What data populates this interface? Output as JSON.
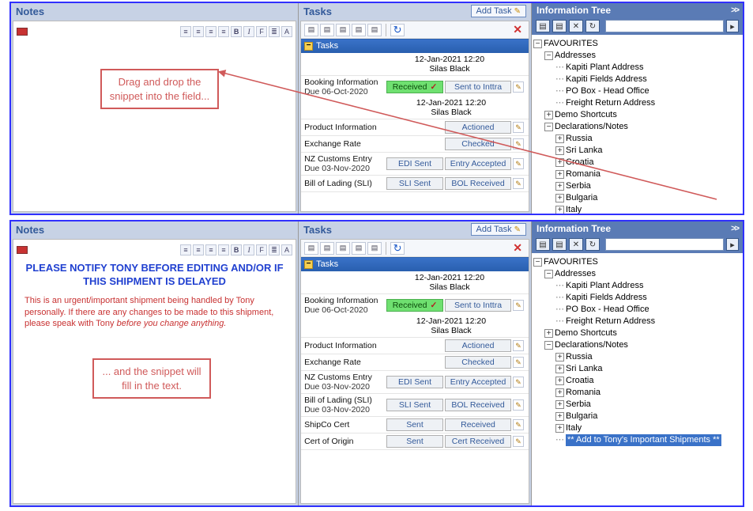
{
  "panels": {
    "notes_title": "Notes",
    "tasks_title": "Tasks",
    "tree_title": "Information Tree",
    "add_task_label": "Add Task",
    "tasks_group": "Tasks"
  },
  "callouts": {
    "top": "Drag and drop the snippet into the field...",
    "bottom": "... and the snippet will fill in the text."
  },
  "notes_filled": {
    "heading": "PLEASE NOTIFY TONY BEFORE EDITING AND/OR IF THIS SHIPMENT IS DELAYED",
    "para_pre": "This is an urgent/important shipment being handled by Tony personally. If there are any changes to be made to this shipment, please speak with Tony ",
    "para_em": "before you change anything.",
    "para_post": ""
  },
  "rt_buttons": [
    "≡",
    "≡",
    "≡",
    "≡",
    "B",
    "I",
    "F",
    "≣",
    "A"
  ],
  "tasks_top": [
    {
      "name": "Booking Information",
      "due": "Due 06-Oct-2020",
      "ts": "12-Jan-2021 12:20",
      "who": "Silas Black",
      "s1": "Received",
      "s1_received": true,
      "s2": "Sent to Inttra"
    },
    {
      "name": "Product Information",
      "due": "",
      "ts": "",
      "who": "",
      "s1": "",
      "s2": "Actioned"
    },
    {
      "name": "Exchange Rate",
      "due": "",
      "ts": "",
      "who": "",
      "s1": "",
      "s2": "Checked"
    },
    {
      "name": "NZ Customs Entry",
      "due": "Due 03-Nov-2020",
      "ts": "",
      "who": "",
      "s1": "EDI Sent",
      "s2": "Entry Accepted"
    },
    {
      "name": "Bill of Lading (SLI)",
      "due": "",
      "ts": "",
      "who": "",
      "s1": "SLI Sent",
      "s2": "BOL Received"
    }
  ],
  "tasks_bottom": [
    {
      "name": "Booking Information",
      "due": "Due 06-Oct-2020",
      "ts": "12-Jan-2021 12:20",
      "who": "Silas Black",
      "s1": "Received",
      "s1_received": true,
      "s2": "Sent to Inttra"
    },
    {
      "name": "Product Information",
      "due": "",
      "ts": "",
      "who": "",
      "s1": "",
      "s2": "Actioned"
    },
    {
      "name": "Exchange Rate",
      "due": "",
      "ts": "",
      "who": "",
      "s1": "",
      "s2": "Checked"
    },
    {
      "name": "NZ Customs Entry",
      "due": "Due 03-Nov-2020",
      "ts": "",
      "who": "",
      "s1": "EDI Sent",
      "s2": "Entry Accepted"
    },
    {
      "name": "Bill of Lading (SLI)",
      "due": "Due 03-Nov-2020",
      "ts": "",
      "who": "",
      "s1": "SLI Sent",
      "s2": "BOL Received"
    },
    {
      "name": "ShipCo Cert",
      "due": "",
      "ts": "",
      "who": "",
      "s1": "Sent",
      "s2": "Received"
    },
    {
      "name": "Cert of Origin",
      "due": "",
      "ts": "",
      "who": "",
      "s1": "Sent",
      "s2": "Cert Received"
    }
  ],
  "tree": {
    "favourites": "FAVOURITES",
    "addresses": "Addresses",
    "addr_items": [
      "Kapiti Plant Address",
      "Kapiti Fields Address",
      "PO Box - Head Office",
      "Freight Return Address"
    ],
    "demo": "Demo Shortcuts",
    "decl": "Declarations/Notes",
    "countries": [
      "Russia",
      "Sri Lanka",
      "Croatia",
      "Romania",
      "Serbia",
      "Bulgaria",
      "Italy"
    ],
    "highlight": "** Add to Tony's Important Shipments **"
  }
}
